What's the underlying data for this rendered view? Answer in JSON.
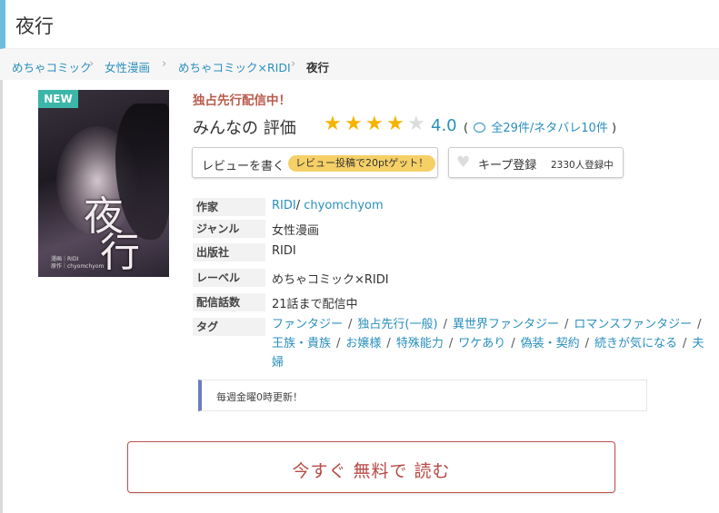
{
  "page": {
    "title": "夜行"
  },
  "breadcrumb": [
    {
      "label": "めちゃコミック"
    },
    {
      "label": "女性漫画"
    },
    {
      "label": "めちゃコミック×RIDI"
    },
    {
      "label": "夜行"
    }
  ],
  "cover": {
    "badge": "NEW",
    "title_char_1": "夜",
    "title_char_2": "行",
    "credit_1": "漫画｜RIDI",
    "credit_2": "原作｜chyomchyom"
  },
  "book": {
    "exclusive_label": "独占先行配信中！",
    "rating_label": "みんなの 評価",
    "rating_value": "4.0",
    "rating_stars": 4,
    "rating_max": 5,
    "reviews_open": "(",
    "reviews_link": "全29件/ネタバレ10件",
    "reviews_close": ")"
  },
  "actions": {
    "write_review": "レビューを書く",
    "review_promo": "レビュー投稿で20ptゲット！",
    "keep": "キープ登録",
    "keep_count": "2330人登録中"
  },
  "info": {
    "author_label": "作家",
    "author_1": "RIDI",
    "author_sep": "/",
    "author_2": "chyomchyom",
    "genre_label": "ジャンル",
    "genre": "女性漫画",
    "publisher_label": "出版社",
    "publisher": "RIDI",
    "label_label": "レーベル",
    "label": "めちゃコミック×RIDI",
    "episodes_label": "配信話数",
    "episodes": "21話まで配信中",
    "tags_label": "タグ",
    "tags": [
      "ファンタジー",
      "独占先行(一般)",
      "異世界ファンタジー",
      "ロマンスファンタジー",
      "王族・貴族",
      "お嬢様",
      "特殊能力",
      "ワケあり",
      "偽装・契約",
      "続きが気になる",
      "夫婦"
    ],
    "tag_sep": "/"
  },
  "notice": {
    "text": "毎週金曜0時更新！"
  },
  "cta": {
    "read_free": "今すぐ 無料で 読む"
  },
  "colors": {
    "accent": "#6bbde0",
    "link": "#2a8fbd",
    "star": "#f4b400",
    "cta": "#c0504d",
    "badge": "#3cb6a9"
  }
}
